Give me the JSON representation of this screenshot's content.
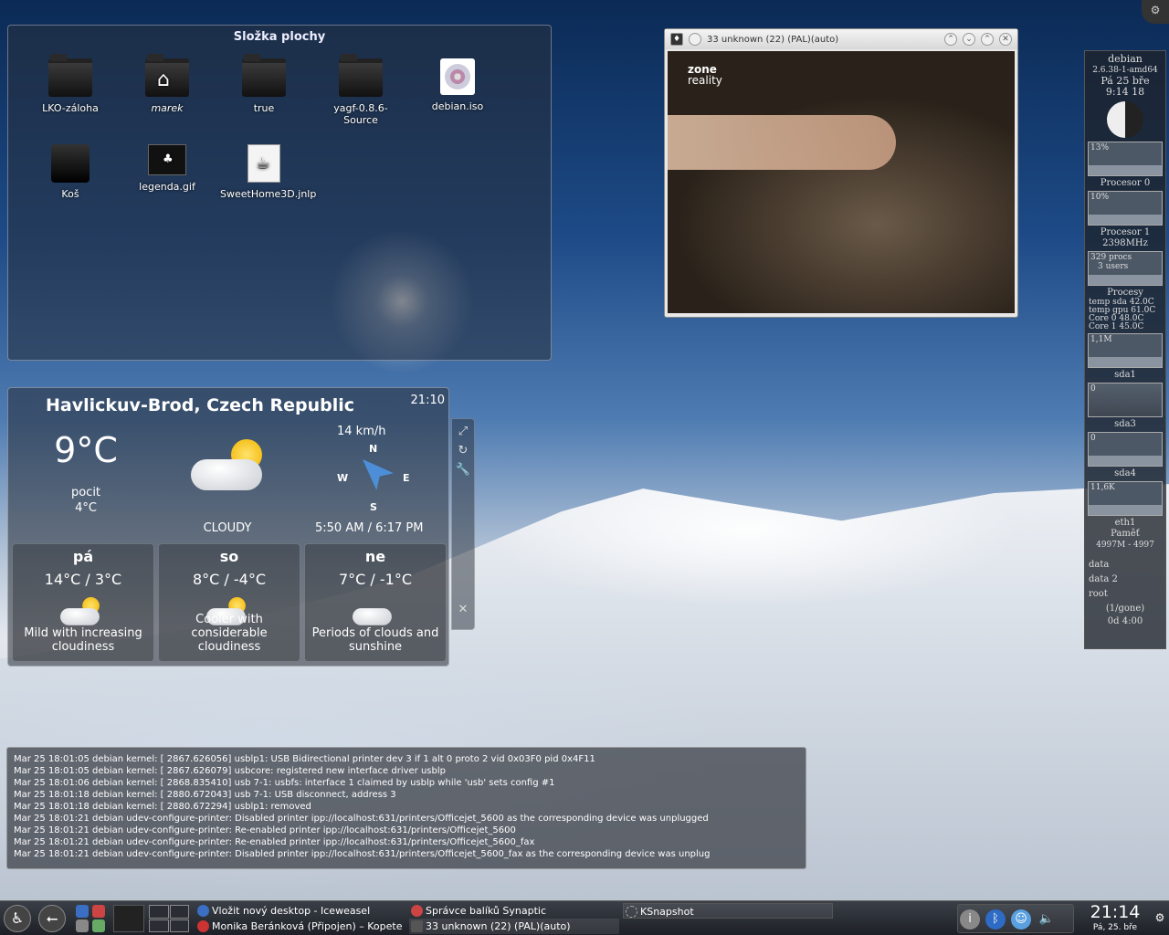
{
  "folderview": {
    "title": "Složka plochy",
    "items": [
      {
        "label": "LKO-záloha",
        "icon": "folder-icon"
      },
      {
        "label": "marek",
        "icon": "home-folder-icon"
      },
      {
        "label": "true",
        "icon": "folder-icon"
      },
      {
        "label": "yagf-0.8.6-Source",
        "icon": "folder-icon"
      },
      {
        "label": "debian.iso",
        "icon": "disc-image-icon"
      },
      {
        "label": "Koš",
        "icon": "trash-icon"
      },
      {
        "label": "legenda.gif",
        "icon": "image-file-icon"
      },
      {
        "label": "SweetHome3D.jnlp",
        "icon": "java-file-icon"
      }
    ]
  },
  "tvwindow": {
    "title": "33   unknown (22) (PAL)(auto)",
    "channel_logo_line1": "zone",
    "channel_logo_line2": "reality"
  },
  "weather": {
    "city": "Havlickuv-Brod, Czech Republic",
    "time": "21:10",
    "temperature": "9°C",
    "feels_label": "pocit",
    "feels_value": "4°C",
    "condition": "CLOUDY",
    "wind_speed": "14 km/h",
    "compass": {
      "n": "N",
      "s": "S",
      "e": "E",
      "w": "W"
    },
    "sunrise_sunset": "5:50 AM / 6:17 PM",
    "forecast": [
      {
        "day": "pá",
        "range": "14°C / 3°C",
        "desc": "Mild with increasing cloudiness"
      },
      {
        "day": "so",
        "range": "8°C / -4°C",
        "desc": "Cooler with considerable cloudiness"
      },
      {
        "day": "ne",
        "range": "7°C / -1°C",
        "desc": "Periods of clouds and sunshine"
      }
    ]
  },
  "conky": {
    "host": "debian",
    "kernel": "2.6.38-1-amd64",
    "date": "Pá 25 bře",
    "time": "9:14 18",
    "cpu0_pct": "13%",
    "cpu0_label": "Procesor 0",
    "cpu1_pct": "10%",
    "cpu1_label": "Procesor 1",
    "freq": "2398MHz",
    "procs": "329 procs",
    "users": "3 users",
    "procs_label": "Procesy",
    "temps": [
      {
        "label": "temp sda",
        "value": "42.0C"
      },
      {
        "label": "temp gpu",
        "value": "61.0C"
      },
      {
        "label": "Core 0",
        "value": "48.0C"
      },
      {
        "label": "Core 1",
        "value": "45.0C"
      }
    ],
    "sda1_val": "1,1M",
    "sda1": "sda1",
    "sda3_val": "0",
    "sda3": "sda3",
    "sda4_val": "0",
    "sda4": "sda4",
    "eth1_val": "11,6K",
    "eth1": "eth1",
    "mem_label": "Paměť",
    "mem_value": "4997M - 4997",
    "mounts": [
      "data",
      "data 2",
      "root"
    ],
    "gone": "(1/gone)",
    "uptime": "0d  4:00"
  },
  "log": {
    "lines": [
      "Mar 25 18:01:05 debian kernel: [ 2867.626056] usblp1: USB Bidirectional printer dev 3 if 1 alt 0 proto 2 vid 0x03F0 pid 0x4F11",
      "Mar 25 18:01:05 debian kernel: [ 2867.626079] usbcore: registered new interface driver usblp",
      "Mar 25 18:01:06 debian kernel: [ 2868.835410] usb 7-1: usbfs: interface 1 claimed by usblp while 'usb' sets config #1",
      "Mar 25 18:01:18 debian kernel: [ 2880.672043] usb 7-1: USB disconnect, address 3",
      "Mar 25 18:01:18 debian kernel: [ 2880.672294] usblp1: removed",
      "Mar 25 18:01:21 debian udev-configure-printer: Disabled printer ipp://localhost:631/printers/Officejet_5600 as the corresponding device was unplugged",
      "Mar 25 18:01:21 debian udev-configure-printer: Re-enabled printer ipp://localhost:631/printers/Officejet_5600",
      "Mar 25 18:01:21 debian udev-configure-printer: Re-enabled printer ipp://localhost:631/printers/Officejet_5600_fax",
      "Mar 25 18:01:21 debian udev-configure-printer: Disabled printer ipp://localhost:631/printers/Officejet_5600_fax as the corresponding device was unplug"
    ]
  },
  "panel": {
    "tasks": [
      {
        "label": "Vložit nový desktop - Iceweasel",
        "color": "#3a6fc4"
      },
      {
        "label": "Správce balíků Synaptic",
        "color": "#c44"
      },
      {
        "label": "KSnapshot",
        "color": "#888"
      },
      {
        "label": "Monika Beránková (Připojen) – Kopete",
        "color": "#c33"
      },
      {
        "label": "33   unknown (22) (PAL)(auto)",
        "color": "#777"
      }
    ],
    "clock_time": "21:14",
    "clock_date": "Pá, 25. bře"
  }
}
